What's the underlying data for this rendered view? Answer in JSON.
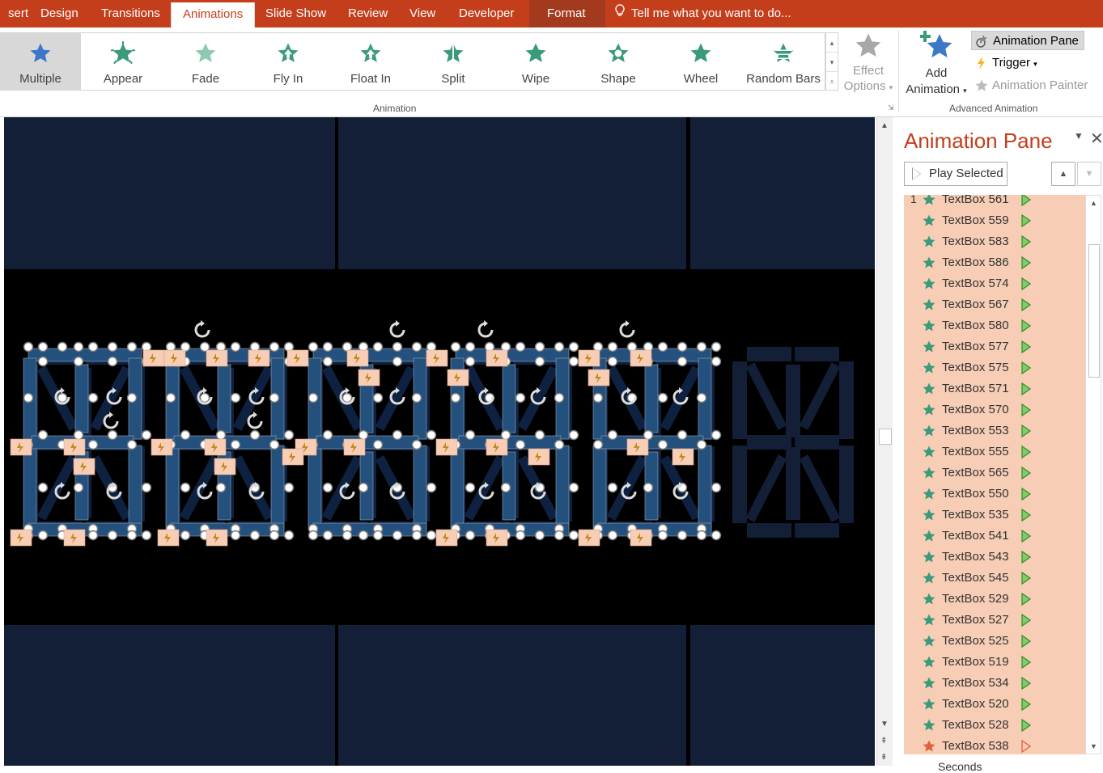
{
  "tabs": [
    "sert",
    "Design",
    "Transitions",
    "Animations",
    "Slide Show",
    "Review",
    "View",
    "Developer",
    "Format"
  ],
  "tell_me": "Tell me what you want to do...",
  "gallery": [
    {
      "label": "Multiple",
      "icon": "star-blue-icon",
      "selected": true
    },
    {
      "label": "Appear",
      "icon": "appear-star-icon"
    },
    {
      "label": "Fade",
      "icon": "fade-star-icon"
    },
    {
      "label": "Fly In",
      "icon": "flyin-star-icon"
    },
    {
      "label": "Float In",
      "icon": "floatin-star-icon"
    },
    {
      "label": "Split",
      "icon": "split-star-icon"
    },
    {
      "label": "Wipe",
      "icon": "wipe-star-icon"
    },
    {
      "label": "Shape",
      "icon": "shape-star-icon"
    },
    {
      "label": "Wheel",
      "icon": "wheel-star-icon"
    },
    {
      "label": "Random Bars",
      "icon": "randombars-star-icon"
    }
  ],
  "group_animation": "Animation",
  "effect_options": {
    "line1": "Effect",
    "line2": "Options"
  },
  "add_animation": {
    "line1": "Add",
    "line2": "Animation"
  },
  "advanced": {
    "animation_pane": "Animation Pane",
    "trigger": "Trigger",
    "animation_painter": "Animation Painter",
    "group_label": "Advanced Animation"
  },
  "pane": {
    "title": "Animation Pane",
    "play_selected": "Play Selected",
    "first_number": "1",
    "items": [
      "TextBox 561",
      "TextBox 559",
      "TextBox 583",
      "TextBox 586",
      "TextBox 574",
      "TextBox 567",
      "TextBox 580",
      "TextBox 577",
      "TextBox 575",
      "TextBox 571",
      "TextBox 570",
      "TextBox 553",
      "TextBox 555",
      "TextBox 565",
      "TextBox 550",
      "TextBox 535",
      "TextBox 541",
      "TextBox 543",
      "TextBox 545",
      "TextBox 529",
      "TextBox 527",
      "TextBox 525",
      "TextBox 519",
      "TextBox 534",
      "TextBox 520",
      "TextBox 528",
      "TextBox 538"
    ],
    "seconds_label": "Seconds"
  },
  "colors": {
    "accent": "#c43e1c",
    "list_bg": "#f7cdb5",
    "entrance_star": "#3a9a7a",
    "emphasis_star": "#e0603a",
    "slide_navy": "#131e37",
    "segment_blue": "#24507d"
  }
}
